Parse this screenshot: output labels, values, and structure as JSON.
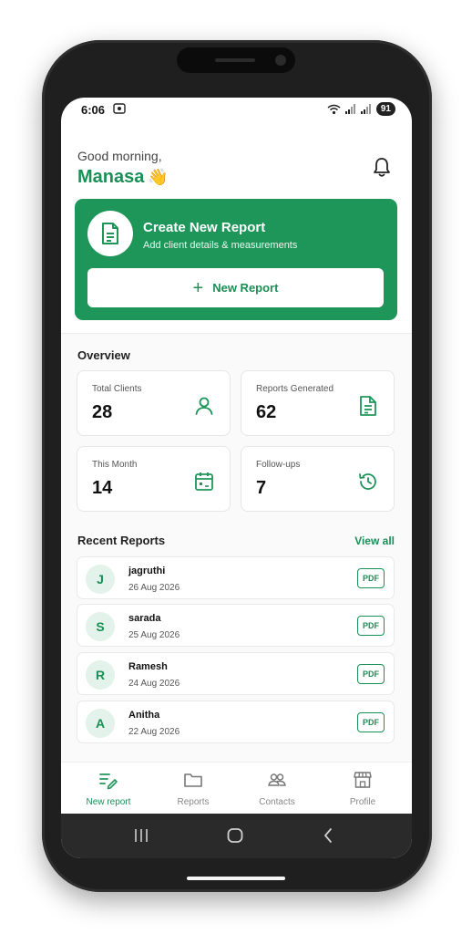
{
  "status_bar": {
    "time": "6:06",
    "battery": "91"
  },
  "header": {
    "greeting": "Good morning,",
    "user_name": "Manasa",
    "wave": "👋"
  },
  "create_card": {
    "title": "Create New Report",
    "subtitle": "Add client details & measurements",
    "button_label": "New Report"
  },
  "overview": {
    "title": "Overview",
    "stats": [
      {
        "label": "Total Clients",
        "value": "28",
        "icon": "user-icon"
      },
      {
        "label": "Reports Generated",
        "value": "62",
        "icon": "document-icon"
      },
      {
        "label": "This Month",
        "value": "14",
        "icon": "calendar-icon"
      },
      {
        "label": "Follow-ups",
        "value": "7",
        "icon": "history-icon"
      }
    ]
  },
  "recent": {
    "title": "Recent Reports",
    "view_all": "View all",
    "pdf_label": "PDF",
    "items": [
      {
        "initial": "J",
        "name": "jagruthi",
        "date": "26 Aug 2026"
      },
      {
        "initial": "S",
        "name": "sarada",
        "date": "25 Aug 2026"
      },
      {
        "initial": "R",
        "name": "Ramesh",
        "date": "24 Aug 2026"
      },
      {
        "initial": "A",
        "name": "Anitha",
        "date": "22 Aug 2026"
      }
    ]
  },
  "bottom_nav": {
    "items": [
      {
        "label": "New report",
        "icon": "edit-list-icon",
        "active": true
      },
      {
        "label": "Reports",
        "icon": "folder-icon",
        "active": false
      },
      {
        "label": "Contacts",
        "icon": "contacts-icon",
        "active": false
      },
      {
        "label": "Profile",
        "icon": "store-icon",
        "active": false
      }
    ]
  },
  "colors": {
    "accent": "#1e9659",
    "text_dark": "#111111",
    "muted": "#888888"
  }
}
